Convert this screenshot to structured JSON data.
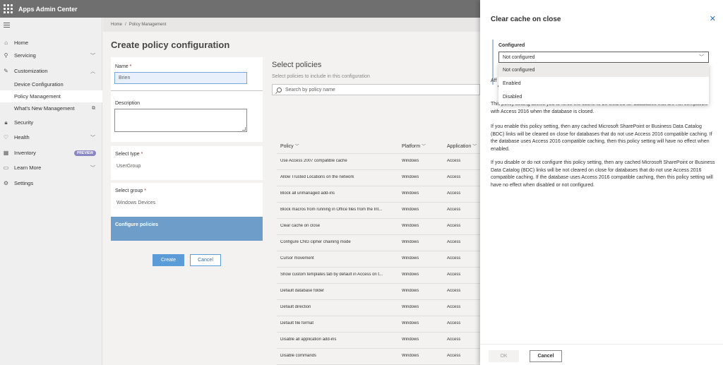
{
  "app": {
    "title": "Apps Admin Center"
  },
  "nav": {
    "home": "Home",
    "servicing": "Servicing",
    "customization": "Customization",
    "device_configuration": "Device Configuration",
    "policy_management": "Policy Management",
    "whats_new": "What's New Management",
    "security": "Security",
    "health": "Health",
    "inventory": "Inventory",
    "inventory_badge": "PREVIEW",
    "learn_more": "Learn More",
    "settings": "Settings"
  },
  "breadcrumb": {
    "home": "Home",
    "separator": "/",
    "current": "Policy Management"
  },
  "page": {
    "title": "Create policy configuration"
  },
  "form": {
    "name_label": "Name",
    "required_mark": "*",
    "name_value": "Brien",
    "description_label": "Description",
    "description_value": "",
    "select_type_label": "Select type",
    "select_type_value": "UserGroup",
    "select_group_label": "Select group",
    "select_group_value": "Windows Devices",
    "configure_policies_label": "Configure policies",
    "create_button": "Create",
    "cancel_button": "Cancel"
  },
  "policies": {
    "title": "Select policies",
    "subtitle": "Select policies to include in this configuration",
    "search_placeholder": "Search by policy name",
    "columns": {
      "policy": "Policy",
      "platform": "Platform",
      "application": "Application"
    },
    "rows": [
      {
        "policy": "Use Access 2007 compatible cache",
        "platform": "Windows",
        "application": "Access"
      },
      {
        "policy": "Allow Trusted Locations on the network",
        "platform": "Windows",
        "application": "Access"
      },
      {
        "policy": "Block all unmanaged add-ins",
        "platform": "Windows",
        "application": "Access"
      },
      {
        "policy": "Block macros from running in Office files from the Int...",
        "platform": "Windows",
        "application": "Access"
      },
      {
        "policy": "Clear cache on close",
        "platform": "Windows",
        "application": "Access"
      },
      {
        "policy": "Configure CNG cipher chaining mode",
        "platform": "Windows",
        "application": "Access"
      },
      {
        "policy": "Cursor movement",
        "platform": "Windows",
        "application": "Access"
      },
      {
        "policy": "Show custom templates tab by default in Access on t...",
        "platform": "Windows",
        "application": "Access"
      },
      {
        "policy": "Default database folder",
        "platform": "Windows",
        "application": "Access"
      },
      {
        "policy": "Default direction",
        "platform": "Windows",
        "application": "Access"
      },
      {
        "policy": "Default file format",
        "platform": "Windows",
        "application": "Access"
      },
      {
        "policy": "Disable all application add-ins",
        "platform": "Windows",
        "application": "Access"
      },
      {
        "policy": "Disable commands",
        "platform": "Windows",
        "application": "Access"
      }
    ]
  },
  "panel": {
    "title": "Clear cache on close",
    "configured_label": "Configured",
    "dropdown_value": "Not configured",
    "options": [
      "Not configured",
      "Enabled",
      "Disabled"
    ],
    "partial_text_1": "Aff",
    "partial_text_2": "W",
    "para1": "This policy setting allows you to force the cache to be cleared for databases that are not compatible with Access 2016 when the database is closed.",
    "para2": "If you enable this policy setting, then any cached Microsoft SharePoint or Business Data Catalog (BDC) links will be cleared on close for databases that do not use Access 2016 compatible caching. If the database uses Access 2016 compatible caching, then this policy setting will have no effect when enabled.",
    "para3": "If you disable or do not configure this policy setting, then any cached Microsoft SharePoint or Business Data Catalog (BDC) links will be not cleared on close for databases that do not use Access 2016 compatible caching. If the database uses Access 2016 compatible caching, then this policy setting will have no effect when disabled or not configured.",
    "ok_button": "OK",
    "cancel_button": "Cancel"
  }
}
